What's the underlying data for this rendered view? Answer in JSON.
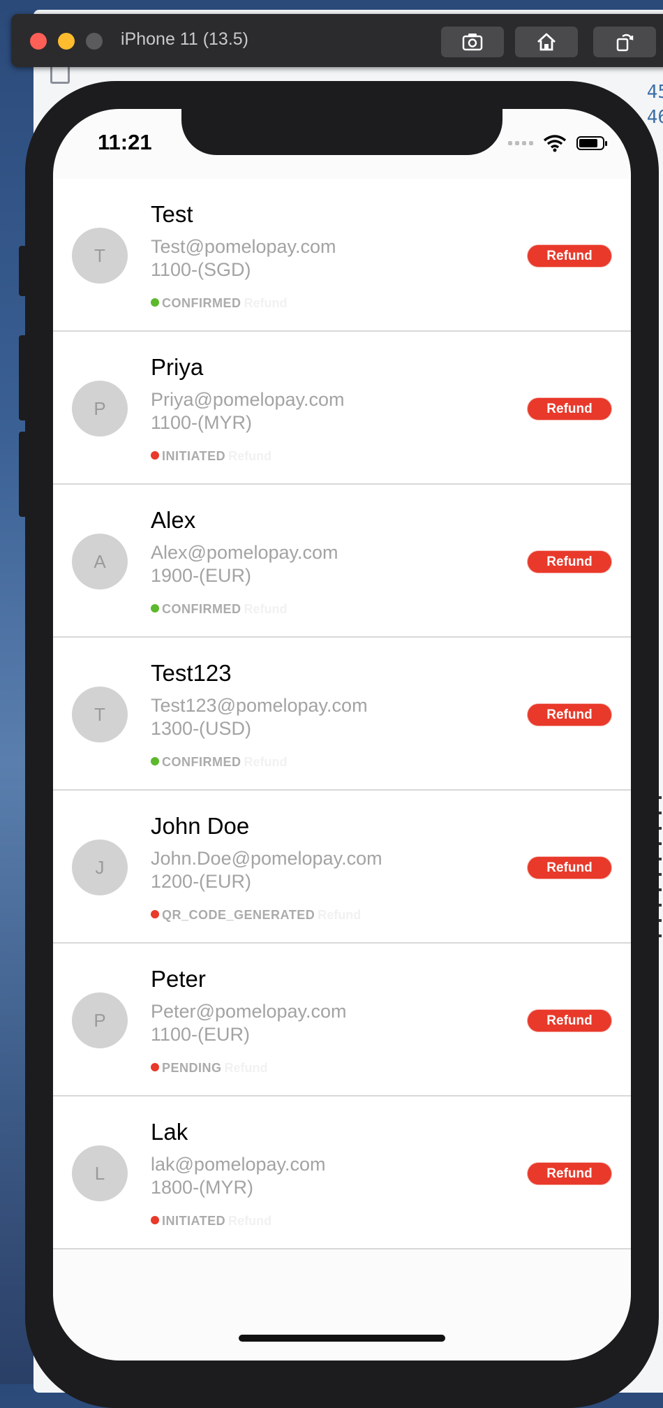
{
  "simulator": {
    "title": "iPhone 11 (13.5)",
    "buttons": [
      "screenshot-icon",
      "home-icon",
      "rotate-icon"
    ]
  },
  "background_code": [
    "45",
    "46"
  ],
  "status_bar": {
    "time": "11:21"
  },
  "colors": {
    "refund_button": "#e8392a",
    "status_green": "#5cb82c",
    "status_red": "#e8392a"
  },
  "payments": [
    {
      "initial": "T",
      "name": "Test",
      "email": "Test@pomelopay.com",
      "amount": "1100-(SGD)",
      "status": "CONFIRMED",
      "status_color": "green",
      "ghost": "Refund",
      "button": "Refund"
    },
    {
      "initial": "P",
      "name": "Priya",
      "email": "Priya@pomelopay.com",
      "amount": "1100-(MYR)",
      "status": "INITIATED",
      "status_color": "red",
      "ghost": "Refund",
      "button": "Refund"
    },
    {
      "initial": "A",
      "name": "Alex",
      "email": "Alex@pomelopay.com",
      "amount": "1900-(EUR)",
      "status": "CONFIRMED",
      "status_color": "green",
      "ghost": "Refund",
      "button": "Refund"
    },
    {
      "initial": "T",
      "name": "Test123",
      "email": "Test123@pomelopay.com",
      "amount": "1300-(USD)",
      "status": "CONFIRMED",
      "status_color": "green",
      "ghost": "Refund",
      "button": "Refund"
    },
    {
      "initial": "J",
      "name": "John Doe",
      "email": "John.Doe@pomelopay.com",
      "amount": "1200-(EUR)",
      "status": "QR_CODE_GENERATED",
      "status_color": "red",
      "ghost": "Refund",
      "button": "Refund"
    },
    {
      "initial": "P",
      "name": "Peter",
      "email": "Peter@pomelopay.com",
      "amount": "1100-(EUR)",
      "status": "PENDING",
      "status_color": "red",
      "ghost": "Refund",
      "button": "Refund"
    },
    {
      "initial": "L",
      "name": "Lak",
      "email": "lak@pomelopay.com",
      "amount": "1800-(MYR)",
      "status": "INITIATED",
      "status_color": "red",
      "ghost": "Refund",
      "button": "Refund"
    }
  ]
}
